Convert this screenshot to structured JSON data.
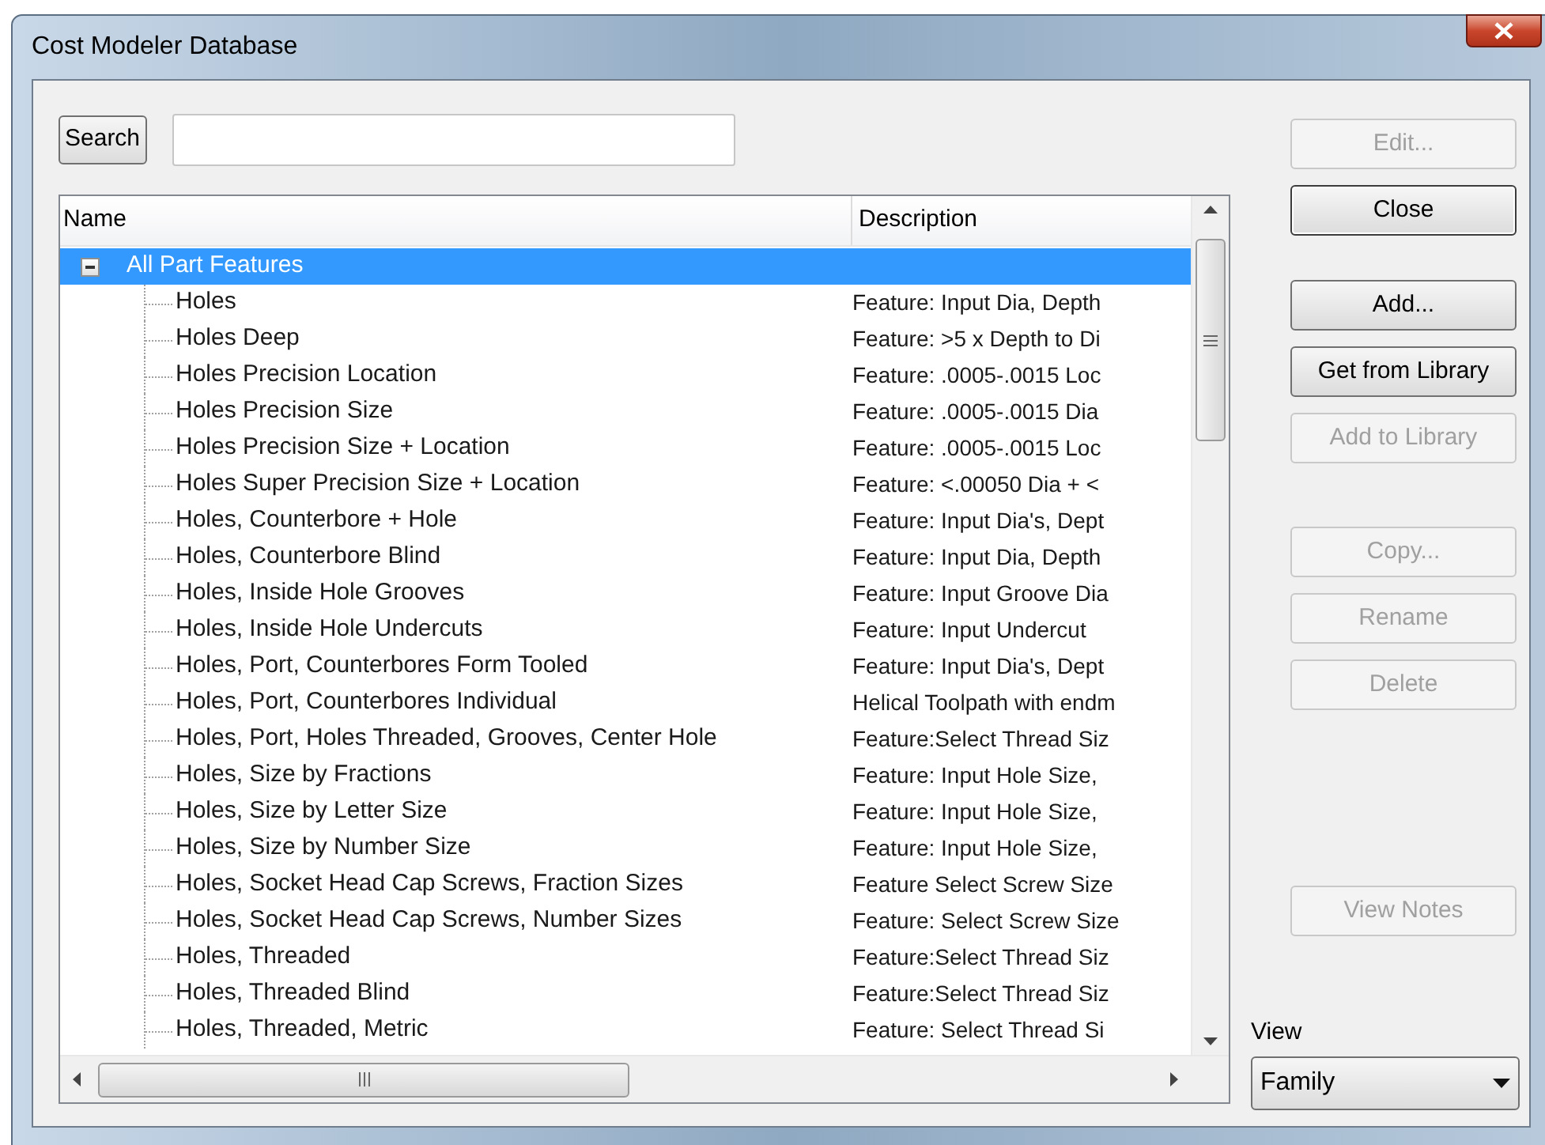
{
  "window": {
    "title": "Cost Modeler Database"
  },
  "search": {
    "button": "Search"
  },
  "list": {
    "columns": [
      "Name",
      "Description"
    ],
    "tree": [
      {
        "name": "All Part Features",
        "selected": true,
        "expanded": true,
        "children": [
          {
            "name": "Holes",
            "description": "Feature: Input Dia, Depth",
            "selected": false
          },
          {
            "name": "Holes Deep",
            "description": "Feature: >5 x Depth to Di",
            "selected": false
          },
          {
            "name": "Holes Precision Location",
            "description": "Feature: .0005-.0015 Loc",
            "selected": false
          },
          {
            "name": "Holes Precision Size",
            "description": "Feature: .0005-.0015 Dia",
            "selected": false
          },
          {
            "name": "Holes Precision Size + Location",
            "description": "Feature: .0005-.0015 Loc",
            "selected": false
          },
          {
            "name": "Holes Super Precision Size + Location",
            "description": "Feature: <.00050 Dia + <",
            "selected": false
          },
          {
            "name": "Holes, Counterbore + Hole",
            "description": "Feature: Input Dia's, Dept",
            "selected": false
          },
          {
            "name": "Holes, Counterbore Blind",
            "description": "Feature: Input Dia, Depth",
            "selected": false
          },
          {
            "name": "Holes, Inside Hole Grooves",
            "description": "Feature: Input Groove Dia",
            "selected": false
          },
          {
            "name": "Holes, Inside Hole Undercuts",
            "description": "Feature: Input Undercut",
            "selected": false
          },
          {
            "name": "Holes, Port, Counterbores Form Tooled",
            "description": "Feature: Input Dia's, Dept",
            "selected": false
          },
          {
            "name": "Holes, Port, Counterbores Individual",
            "description": "Helical Toolpath with endm",
            "selected": false
          },
          {
            "name": "Holes, Port, Holes Threaded, Grooves, Center Hole",
            "description": "Feature:Select Thread Siz",
            "selected": false
          },
          {
            "name": "Holes, Size by Fractions",
            "description": "Feature: Input Hole Size,",
            "selected": false
          },
          {
            "name": "Holes, Size by Letter Size",
            "description": "Feature: Input Hole Size,",
            "selected": false
          },
          {
            "name": "Holes, Size by Number Size",
            "description": "Feature: Input Hole Size,",
            "selected": false
          },
          {
            "name": "Holes, Socket Head Cap Screws, Fraction Sizes",
            "description": "Feature Select Screw Size",
            "selected": false
          },
          {
            "name": "Holes, Socket Head Cap Screws, Number Sizes",
            "description": "Feature: Select Screw Size",
            "selected": false
          },
          {
            "name": "Holes, Threaded",
            "description": "Feature:Select Thread Siz",
            "selected": false
          },
          {
            "name": "Holes, Threaded Blind",
            "description": "Feature:Select Thread Siz",
            "selected": false
          },
          {
            "name": "Holes, Threaded, Metric",
            "description": "Feature: Select Thread Si",
            "selected": false
          }
        ]
      }
    ]
  },
  "button_groups": [
    [
      {
        "label": "Edit...",
        "disabled": true,
        "default": false
      },
      {
        "label": "Close",
        "disabled": false,
        "default": true
      }
    ],
    [
      {
        "label": "Add...",
        "disabled": false,
        "default": false
      },
      {
        "label": "Get from Library",
        "disabled": false,
        "default": false
      },
      {
        "label": "Add to Library",
        "disabled": true,
        "default": false
      }
    ],
    [
      {
        "label": "Copy...",
        "disabled": true,
        "default": false
      },
      {
        "label": "Rename",
        "disabled": true,
        "default": false
      },
      {
        "label": "Delete",
        "disabled": true,
        "default": false
      }
    ],
    [
      {
        "label": "View Notes",
        "disabled": true,
        "default": false
      }
    ]
  ],
  "view": {
    "label": "View",
    "value": "Family"
  }
}
